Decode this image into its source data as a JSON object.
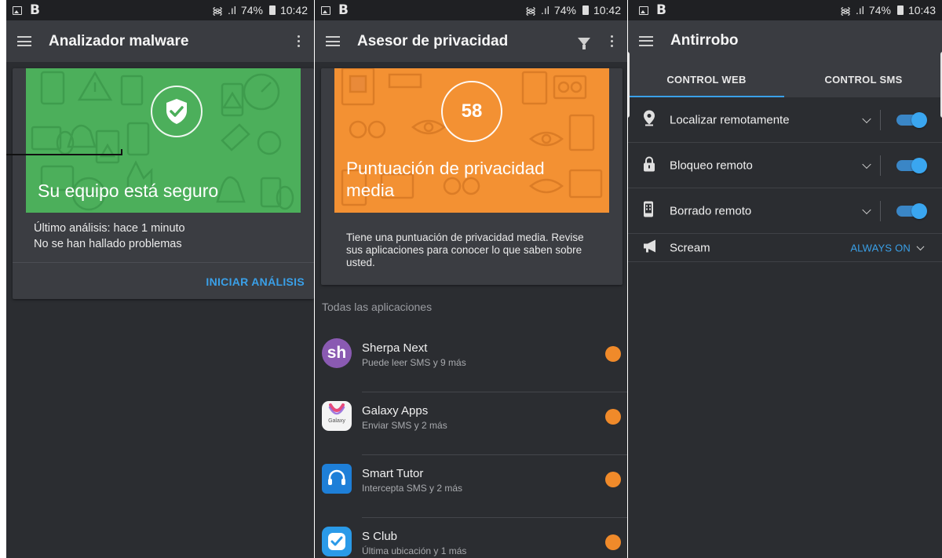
{
  "screens": {
    "malware": {
      "status": {
        "battery": "74%",
        "time": "10:42"
      },
      "title": "Analizador malware",
      "hero_text": "Su equipo está seguro",
      "line1": "Último análisis: hace 1 minuto",
      "line2": "No se han hallado problemas",
      "action": "INICIAR ANÁLISIS",
      "hero_color": "#4caf5b"
    },
    "privacy": {
      "status": {
        "battery": "74%",
        "time": "10:42"
      },
      "title": "Asesor de privacidad",
      "score": "58",
      "hero_text_line1": "Puntuación de privacidad",
      "hero_text_line2": "media",
      "description": "Tiene una puntuación de privacidad media. Revise sus aplicaciones para conocer lo que saben sobre usted.",
      "section_label": "Todas las aplicaciones",
      "hero_color": "#f39133",
      "apps": [
        {
          "name": "Sherpa Next",
          "sub": "Puede leer SMS y 9 más",
          "icon": "sherpa-icon",
          "icon_text": "sh"
        },
        {
          "name": "Galaxy Apps",
          "sub": "Enviar SMS y 2 más",
          "icon": "galaxy-apps-icon",
          "icon_text": "Galaxy"
        },
        {
          "name": "Smart Tutor",
          "sub": "Intercepta SMS y 2 más",
          "icon": "headset-icon"
        },
        {
          "name": "S Club",
          "sub": "Última ubicación y 1 más",
          "icon": "check-badge-icon"
        }
      ]
    },
    "antitheft": {
      "status": {
        "battery": "74%",
        "time": "10:43"
      },
      "title": "Antirrobo",
      "tabs": [
        "CONTROL WEB",
        "CONTROL SMS"
      ],
      "settings": [
        {
          "label": "Localizar remotamente",
          "icon": "location-pin-icon",
          "enabled": true
        },
        {
          "label": "Bloqueo remoto",
          "icon": "lock-icon",
          "enabled": true
        },
        {
          "label": "Borrado remoto",
          "icon": "phone-wipe-icon",
          "enabled": true
        }
      ],
      "scream": {
        "label": "Scream",
        "value": "ALWAYS ON",
        "icon": "megaphone-icon"
      }
    }
  },
  "colors": {
    "accent": "#3aa0e8",
    "background": "#2b2d31",
    "appbar": "#3a3c41",
    "warning_dot": "#f08a2a"
  }
}
